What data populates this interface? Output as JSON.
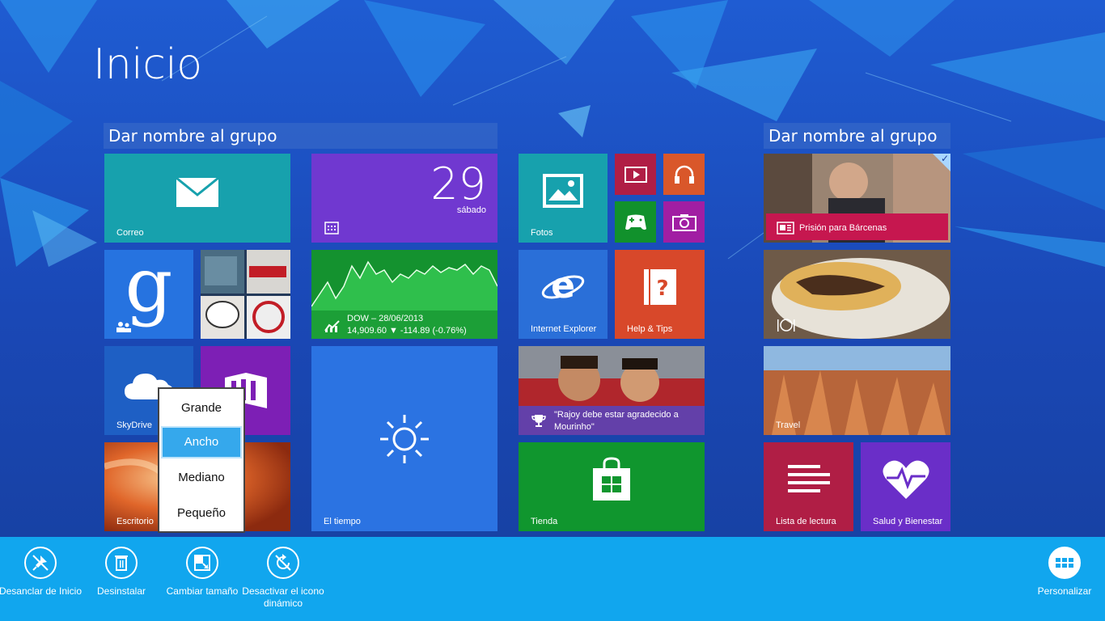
{
  "screen": {
    "title": "Inicio"
  },
  "groups": [
    {
      "name": "Dar nombre al grupo"
    },
    {
      "name": "Dar nombre al grupo"
    }
  ],
  "tiles": {
    "mail": {
      "label": "Correo",
      "color": "#17a1ad"
    },
    "calendar": {
      "day_number": "29",
      "day_name": "sábado",
      "color": "#7038d0"
    },
    "photos": {
      "label": "Fotos",
      "color": "#17a1ad"
    },
    "video": {
      "color": "#b01e45"
    },
    "music": {
      "color": "#d9572a"
    },
    "games": {
      "color": "#11912c"
    },
    "camera": {
      "color": "#a11ea3"
    },
    "google": {
      "color": "#2673e0"
    },
    "finance": {
      "index": "DOW – 28/06/2013",
      "quote": "14,909.60 ▼ -114.89 (-0.76%)",
      "color": "#14922f"
    },
    "ie": {
      "label": "Internet Explorer",
      "color": "#2a6fd8"
    },
    "help": {
      "label": "Help & Tips",
      "color": "#d8482a"
    },
    "skydrive": {
      "label": "SkyDrive",
      "color": "#1e5fc4"
    },
    "store_purple": {
      "color": "#7d1fb5"
    },
    "weather": {
      "label": "El tiempo",
      "color": "#2b73e2"
    },
    "sports": {
      "headline": "\"Rajoy debe estar agradecido a Mourinho\""
    },
    "desktop": {
      "label": "Escritorio"
    },
    "store": {
      "label": "Tienda",
      "color": "#10962e"
    },
    "news": {
      "headline": "Prisión para Bárcenas",
      "color": "#c6174f"
    },
    "travel": {
      "label": "Travel"
    },
    "reading": {
      "label": "Lista de lectura",
      "color": "#b01e45"
    },
    "health": {
      "label": "Salud y Bienestar",
      "color": "#6a2ec8"
    }
  },
  "resize_menu": {
    "options": [
      "Grande",
      "Ancho",
      "Mediano",
      "Pequeño"
    ],
    "selected": "Ancho"
  },
  "app_bar": {
    "unpin": "Desanclar de Inicio",
    "uninstall": "Desinstalar",
    "resize": "Cambiar tamaño",
    "live_tile": "Desactivar el icono dinámico",
    "customize": "Personalizar",
    "color": "#11a6ee"
  }
}
